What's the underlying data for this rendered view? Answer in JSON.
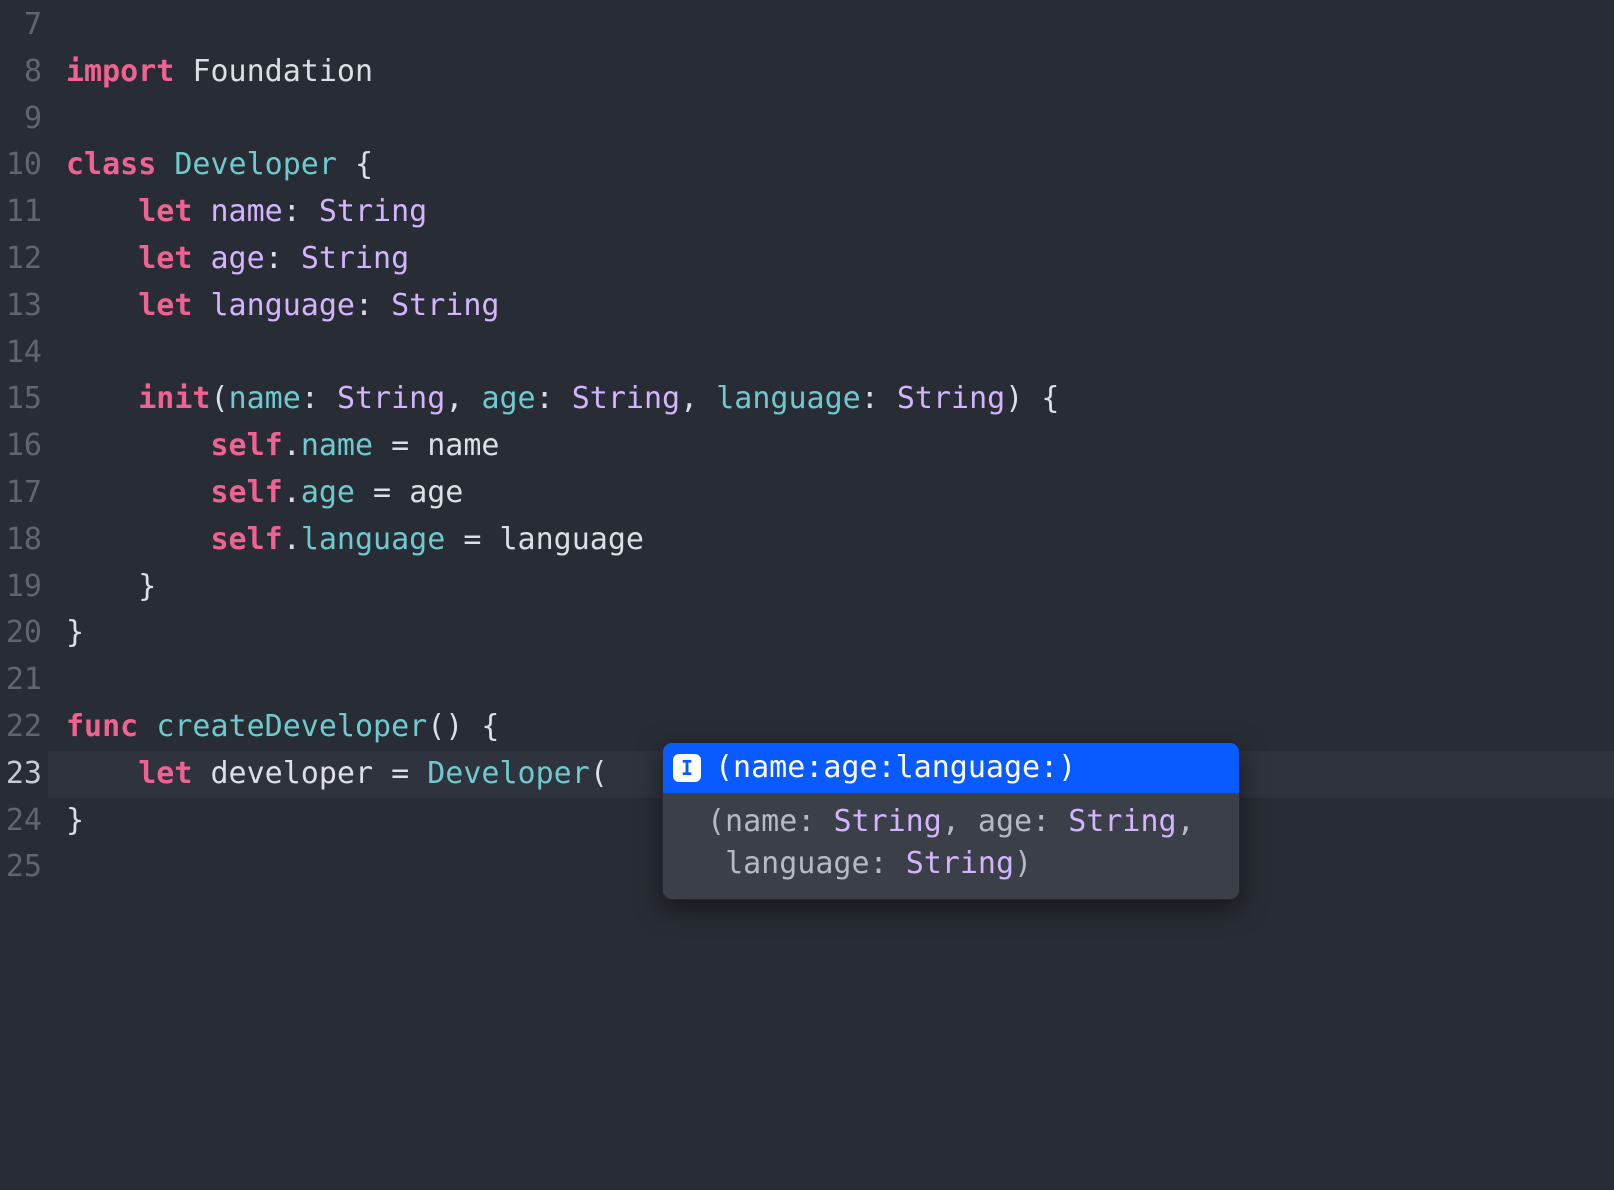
{
  "gutter": {
    "start": 7,
    "end": 25,
    "current": 23
  },
  "code": {
    "l7": "",
    "l8_import": "import",
    "l8_mod": "Foundation",
    "l10_class": "class",
    "l10_name": "Developer",
    "l10_brace": " {",
    "l11_let": "let",
    "l11_name": "name",
    "l11_sep": ": ",
    "l11_type": "String",
    "l12_let": "let",
    "l12_name": "age",
    "l12_sep": ": ",
    "l12_type": "String",
    "l13_let": "let",
    "l13_name": "language",
    "l13_sep": ": ",
    "l13_type": "String",
    "l15_init": "init",
    "l15_open": "(",
    "l15_p1": "name",
    "l15_p1s": ": ",
    "l15_p1t": "String",
    "l15_c1": ", ",
    "l15_p2": "age",
    "l15_p2s": ": ",
    "l15_p2t": "String",
    "l15_c2": ", ",
    "l15_p3": "language",
    "l15_p3s": ": ",
    "l15_p3t": "String",
    "l15_close": ") {",
    "l16_self": "self",
    "l16_dot": ".",
    "l16_prop": "name",
    "l16_eq": " = ",
    "l16_rhs": "name",
    "l17_self": "self",
    "l17_dot": ".",
    "l17_prop": "age",
    "l17_eq": " = ",
    "l17_rhs": "age",
    "l18_self": "self",
    "l18_dot": ".",
    "l18_prop": "language",
    "l18_eq": " = ",
    "l18_rhs": "language",
    "l19_brace": "}",
    "l20_brace": "}",
    "l22_func": "func",
    "l22_name": "createDeveloper",
    "l22_parens": "()",
    "l22_brace": " {",
    "l23_let": "let",
    "l23_name": "developer",
    "l23_eq": " = ",
    "l23_type": "Developer",
    "l23_open": "(",
    "l24_brace": "}"
  },
  "autocomplete": {
    "icon": "I",
    "selectedLabel": "(name:age:language:)",
    "detail_open": "(name: ",
    "detail_t1": "String",
    "detail_c1": ", age: ",
    "detail_t2": "String",
    "detail_c2": ",\n language: ",
    "detail_t3": "String",
    "detail_close": ")"
  }
}
